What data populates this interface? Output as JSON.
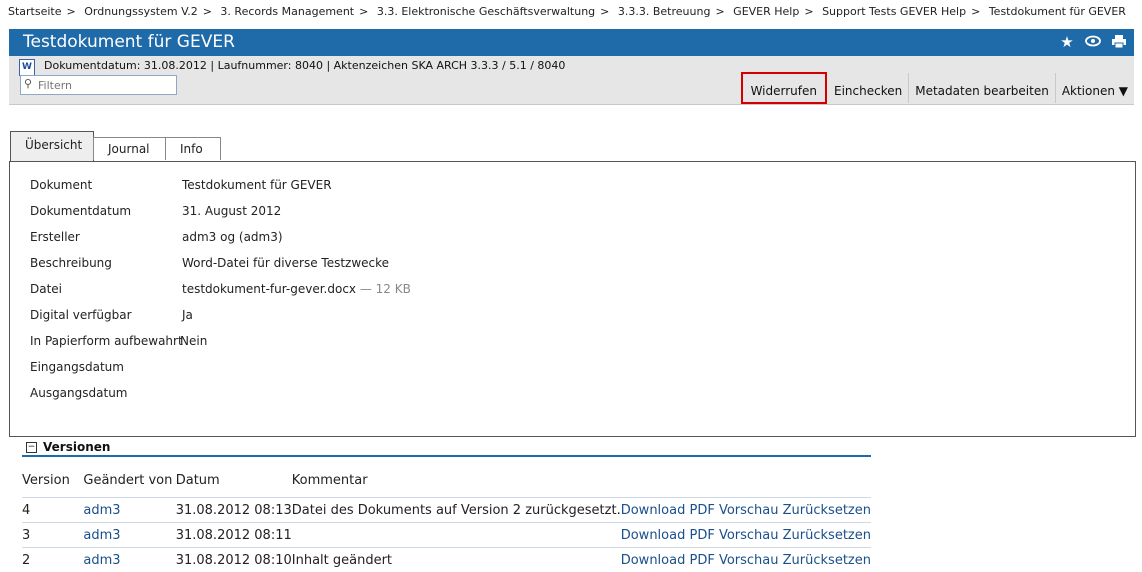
{
  "breadcrumb": [
    "Startseite",
    "Ordnungssystem V.2",
    "3. Records Management",
    "3.3. Elektronische Geschäftsverwaltung",
    "3.3.3. Betreuung",
    "GEVER Help",
    "Support Tests GEVER Help",
    "Testdokument für GEVER"
  ],
  "title": "Testdokument für GEVER",
  "title_icons": [
    "star-icon",
    "eye-icon",
    "print-icon"
  ],
  "meta_line": "Dokumentdatum: 31.08.2012 | Laufnummer: 8040 | Aktenzeichen SKA ARCH 3.3.3 / 5.1 / 8040",
  "filter_placeholder": "Filtern",
  "actions": {
    "widerrufen": "Widerrufen",
    "einchecken": "Einchecken",
    "metadaten": "Metadaten bearbeiten",
    "aktionen": "Aktionen ▼"
  },
  "tabs": [
    "Übersicht",
    "Journal",
    "Info"
  ],
  "overview": [
    {
      "label": "Dokument",
      "value": "Testdokument für GEVER"
    },
    {
      "label": "Dokumentdatum",
      "value": "31. August 2012"
    },
    {
      "label": "Ersteller",
      "value": "adm3 og (adm3)"
    },
    {
      "label": "Beschreibung",
      "value": "Word-Datei für diverse Testzwecke"
    },
    {
      "label": "Datei",
      "value": "testdokument-fur-gever.docx",
      "extra": "— 12 KB"
    },
    {
      "label": "Digital verfügbar",
      "value": "Ja"
    },
    {
      "label": "In Papierform aufbewahrt",
      "value": "Nein"
    },
    {
      "label": "Eingangsdatum",
      "value": ""
    },
    {
      "label": "Ausgangsdatum",
      "value": ""
    }
  ],
  "versions": {
    "title": "Versionen",
    "columns": [
      "Version",
      "Geändert von",
      "Datum",
      "Kommentar"
    ],
    "rows": [
      {
        "version": "4",
        "by": "adm3",
        "date": "31.08.2012 08:13",
        "comment": "Datei des Dokuments auf Version 2 zurückgesetzt.",
        "links": [
          "Download",
          "PDF Vorschau",
          "Zurücksetzen"
        ]
      },
      {
        "version": "3",
        "by": "adm3",
        "date": "31.08.2012 08:11",
        "comment": "",
        "links": [
          "Download",
          "PDF Vorschau",
          "Zurücksetzen"
        ]
      },
      {
        "version": "2",
        "by": "adm3",
        "date": "31.08.2012 08:10",
        "comment": "Inhalt geändert",
        "links": [
          "Download",
          "PDF Vorschau",
          "Zurücksetzen"
        ]
      }
    ]
  }
}
